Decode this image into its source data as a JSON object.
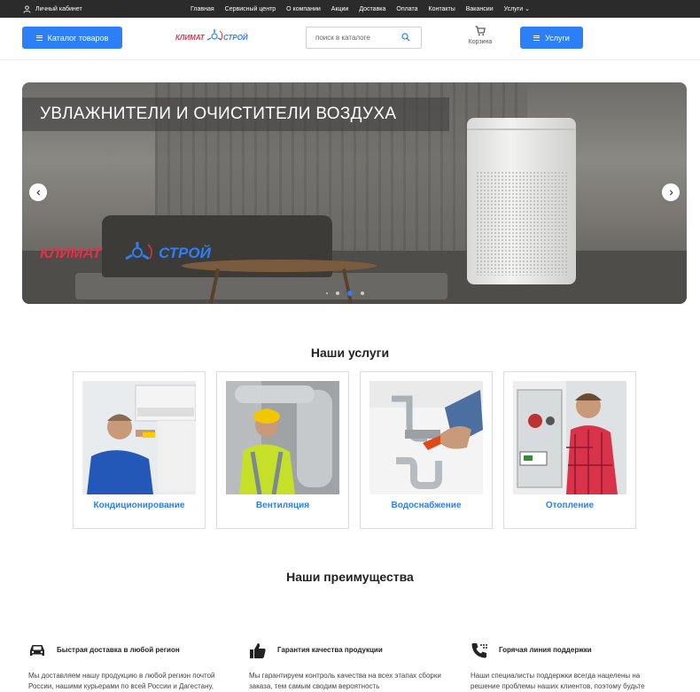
{
  "topbar": {
    "account_label": "Личный кабинет",
    "menu": [
      "Главная",
      "Сервисный центр",
      "О компании",
      "Акции",
      "Доставка",
      "Оплата",
      "Контакты",
      "Вакансии",
      "Услуги ⌄"
    ]
  },
  "header": {
    "catalog_label": "Каталог товаров",
    "search_placeholder": "поиск в каталоге",
    "cart_label": "Корзина",
    "services_label": "Услуги",
    "logo_left": "КЛИМАТ",
    "logo_right": "СТРОЙ"
  },
  "hero": {
    "title": "УВЛАЖНИТЕЛИ И ОЧИСТИТЕЛИ ВОЗДУХА",
    "logo_left": "КЛИМАТ",
    "logo_right": "СТРОЙ",
    "active_slide": 3,
    "slide_count": 4
  },
  "services": {
    "title": "Наши услуги",
    "items": [
      {
        "label": "Кондиционирование",
        "icon": "technician-aircon-photo"
      },
      {
        "label": "Вентиляция",
        "icon": "technician-ventilation-photo"
      },
      {
        "label": "Водоснабжение",
        "icon": "plumbing-photo"
      },
      {
        "label": "Отопление",
        "icon": "technician-boiler-photo"
      }
    ]
  },
  "advantages": {
    "title": "Наши преимущества",
    "items": [
      {
        "icon": "car-icon",
        "head": "Быстрая доставка в любой регион",
        "text": "Мы доставляем нашу продукцию в любой регион почтой России, нашими курьерами по всей России и Дагестану,"
      },
      {
        "icon": "thumbs-up-icon",
        "head": "Гарантия качества продукции",
        "text": "Мы гарантируем контроль качества на всех этапах сборки заказа, тем самым сводим вероятность"
      },
      {
        "icon": "phone-icon",
        "head": "Горячая линия поддержки",
        "text": "Наши специалисты поддержки всегда нацелены на решение проблемы наших клиентов, поэтому будьте"
      }
    ]
  },
  "colors": {
    "accent": "#2c7ff7",
    "topbar": "#2b2b2b",
    "logo_red": "#e0304a"
  }
}
